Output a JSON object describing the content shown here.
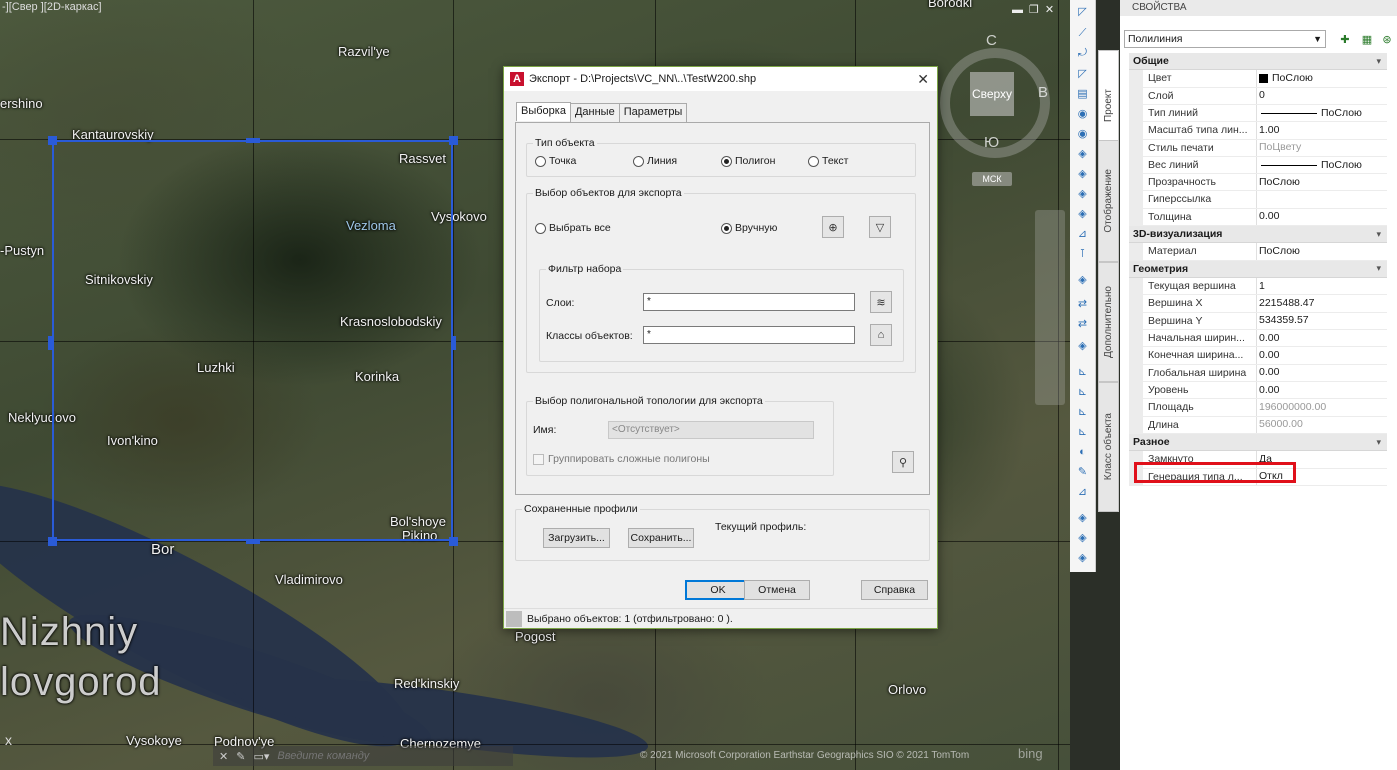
{
  "map": {
    "viewport_label": "-][Свер ][2D-каркас]",
    "places": [
      {
        "name": "Borodki"
      },
      {
        "name": "Razvil'ye"
      },
      {
        "name": "ershino"
      },
      {
        "name": "Kantaurovskiy"
      },
      {
        "name": "Rassvet"
      },
      {
        "name": "Vysokovo"
      },
      {
        "name": "Vezloma"
      },
      {
        "name": "-Pustyn"
      },
      {
        "name": "Sitnikovskiy"
      },
      {
        "name": "Krasnoslobodskiy"
      },
      {
        "name": "Luzhki"
      },
      {
        "name": "Korinka"
      },
      {
        "name": "Neklyudovo"
      },
      {
        "name": "Ivon'kino"
      },
      {
        "name": "Bol'shoye"
      },
      {
        "name": "Pikino"
      },
      {
        "name": "Bor"
      },
      {
        "name": "Vladimirovo"
      },
      {
        "name": "Pogost"
      },
      {
        "name": "Nizhniy"
      },
      {
        "name": "lovgorod"
      },
      {
        "name": "Red'kinskiy"
      },
      {
        "name": "Orlovo"
      },
      {
        "name": "Vysokoye"
      },
      {
        "name": "Podnov'ye"
      },
      {
        "name": "Chernozemye"
      }
    ],
    "viewcube": {
      "top": "Сверху",
      "north": "С",
      "east": "В",
      "south": "Ю",
      "ucs": "МСК"
    },
    "command_placeholder": "Введите команду",
    "copyright": "© 2021 Microsoft Corporation Earthstar Geographics SIO © 2021 TomTom",
    "bing": "bing",
    "ucs_x": "x"
  },
  "dialog": {
    "title": "Экспорт - D:\\Projects\\VC_NN\\..\\TestW200.shp",
    "tabs": [
      "Выборка",
      "Данные",
      "Параметры"
    ],
    "object_type": {
      "label": "Тип объекта",
      "options": [
        "Точка",
        "Линия",
        "Полигон",
        "Текст"
      ],
      "selected": "Полигон"
    },
    "selection": {
      "label": "Выбор объектов для экспорта",
      "select_all": "Выбрать все",
      "manual": "Вручную",
      "selected": "Вручную"
    },
    "filter": {
      "label": "Фильтр набора",
      "layers_label": "Слои:",
      "layers_value": "*",
      "classes_label": "Классы объектов:",
      "classes_value": "*"
    },
    "topology": {
      "label": "Выбор полигональной топологии для экспорта",
      "name_label": "Имя:",
      "name_value": "<Отсутствует>",
      "group_complex": "Группировать сложные полигоны"
    },
    "profiles": {
      "label": "Сохраненные профили",
      "load": "Загрузить...",
      "save": "Сохранить...",
      "current": "Текущий профиль:"
    },
    "buttons": {
      "ok": "OK",
      "cancel": "Отмена",
      "help": "Справка"
    },
    "status": "Выбрано объектов: 1  (отфильтровано: 0 )."
  },
  "side_tabs": [
    "Проект",
    "Отображение",
    "Дополнительно",
    "Класс объекта"
  ],
  "properties": {
    "header": "СВОЙСТВА",
    "object_type": "Полилиния",
    "sections": [
      {
        "title": "Общие",
        "rows": [
          {
            "key": "Цвет",
            "value": "ПоСлою",
            "swatch": "#000000"
          },
          {
            "key": "Слой",
            "value": "0"
          },
          {
            "key": "Тип линий",
            "value": "ПоСлою",
            "line": true
          },
          {
            "key": "Масштаб типа лин...",
            "value": "1.00"
          },
          {
            "key": "Стиль печати",
            "value": "ПоЦвету",
            "dim": true
          },
          {
            "key": "Вес линий",
            "value": "ПоСлою",
            "line": true
          },
          {
            "key": "Прозрачность",
            "value": "ПоСлою"
          },
          {
            "key": "Гиперссылка",
            "value": ""
          },
          {
            "key": "Толщина",
            "value": "0.00"
          }
        ]
      },
      {
        "title": "3D-визуализация",
        "rows": [
          {
            "key": "Материал",
            "value": "ПоСлою"
          }
        ]
      },
      {
        "title": "Геометрия",
        "rows": [
          {
            "key": "Текущая вершина",
            "value": "1"
          },
          {
            "key": "Вершина X",
            "value": "2215488.47"
          },
          {
            "key": "Вершина Y",
            "value": "534359.57"
          },
          {
            "key": "Начальная ширин...",
            "value": "0.00"
          },
          {
            "key": "Конечная ширина...",
            "value": "0.00"
          },
          {
            "key": "Глобальная ширина",
            "value": "0.00"
          },
          {
            "key": "Уровень",
            "value": "0.00"
          },
          {
            "key": "Площадь",
            "value": "196000000.00",
            "dim": true
          },
          {
            "key": "Длина",
            "value": "56000.00",
            "dim": true
          }
        ]
      },
      {
        "title": "Разное",
        "rows": [
          {
            "key": "Замкнуто",
            "value": "Да"
          },
          {
            "key": "Генерация типа л...",
            "value": "Откл"
          }
        ]
      }
    ]
  }
}
